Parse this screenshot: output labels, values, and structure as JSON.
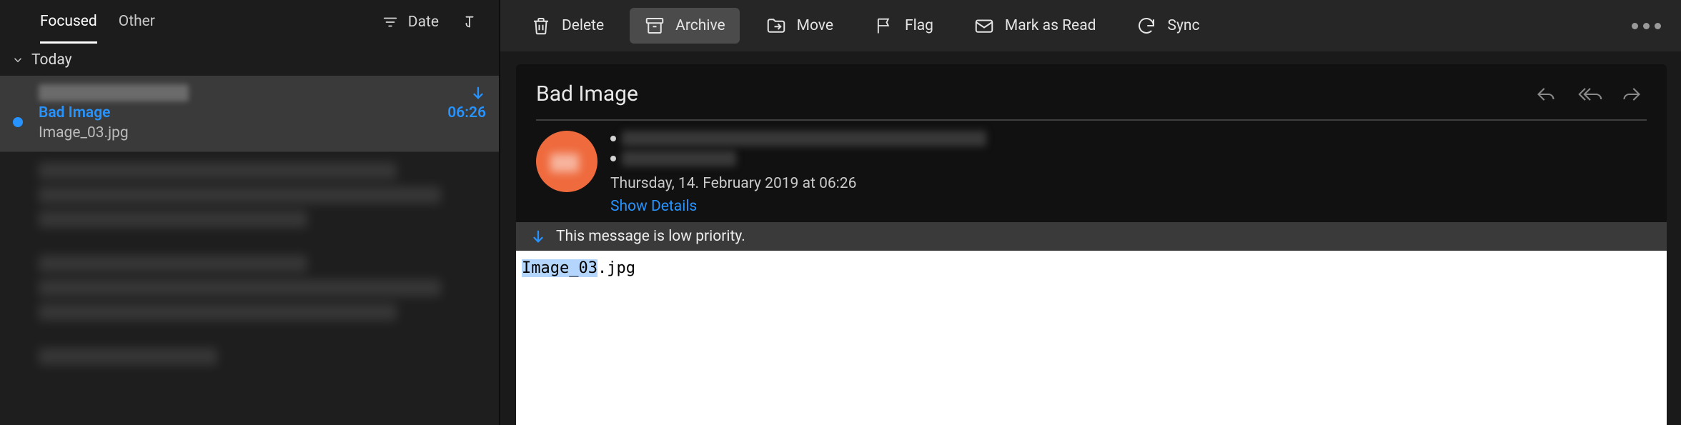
{
  "sidebar": {
    "tabs": {
      "focused": "Focused",
      "other": "Other"
    },
    "filter_label": "Date",
    "section": "Today",
    "selected": {
      "subject": "Bad Image",
      "time": "06:26",
      "preview": "Image_03.jpg"
    }
  },
  "toolbar": {
    "delete": "Delete",
    "archive": "Archive",
    "move": "Move",
    "flag": "Flag",
    "mark_read": "Mark as Read",
    "sync": "Sync"
  },
  "message": {
    "subject": "Bad Image",
    "date_line": "Thursday, 14. February 2019 at 06:26",
    "show_details": "Show Details",
    "priority_text": "This message is low priority.",
    "body_highlight": "Image_03",
    "body_rest": ".jpg"
  },
  "colors": {
    "accent": "#2793ff",
    "avatar": "#ef6a3d"
  }
}
